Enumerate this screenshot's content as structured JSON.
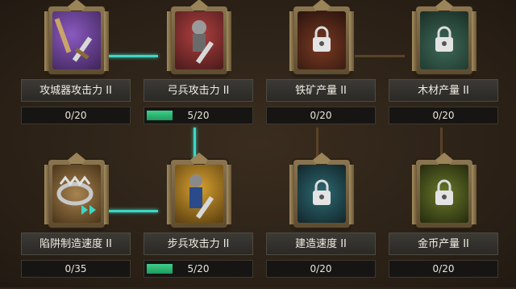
{
  "skills": [
    {
      "id": "siege",
      "label": "攻城器攻击力 II",
      "progress": "0/20",
      "fraction": 0.0,
      "locked": false,
      "icon": "siege-weapon-icon",
      "art": "#5b3a7a"
    },
    {
      "id": "archer",
      "label": "弓兵攻击力 II",
      "progress": "5/20",
      "fraction": 0.25,
      "locked": false,
      "icon": "archer-icon",
      "art": "#7a2b2b"
    },
    {
      "id": "iron",
      "label": "铁矿产量 II",
      "progress": "0/20",
      "fraction": 0.0,
      "locked": true,
      "icon": "lock-icon",
      "art": "#5a2a1e"
    },
    {
      "id": "wood",
      "label": "木材产量 II",
      "progress": "0/20",
      "fraction": 0.0,
      "locked": true,
      "icon": "lock-icon",
      "art": "#2d4a3e"
    },
    {
      "id": "trap",
      "label": "陷阱制造速度 II",
      "progress": "0/35",
      "fraction": 0.0,
      "locked": false,
      "icon": "trap-icon",
      "art": "#7a5a30"
    },
    {
      "id": "infantry",
      "label": "步兵攻击力 II",
      "progress": "5/20",
      "fraction": 0.25,
      "locked": false,
      "icon": "infantry-icon",
      "art": "#8a6a20"
    },
    {
      "id": "build",
      "label": "建造速度 II",
      "progress": "0/20",
      "fraction": 0.0,
      "locked": true,
      "icon": "lock-icon",
      "art": "#234850"
    },
    {
      "id": "gold",
      "label": "金币产量 II",
      "progress": "0/20",
      "fraction": 0.0,
      "locked": true,
      "icon": "lock-icon",
      "art": "#4a5a22"
    }
  ],
  "colors": {
    "accent": "#3fd6c4",
    "progress": "#2fb874",
    "locked_connector": "#5a4228"
  }
}
